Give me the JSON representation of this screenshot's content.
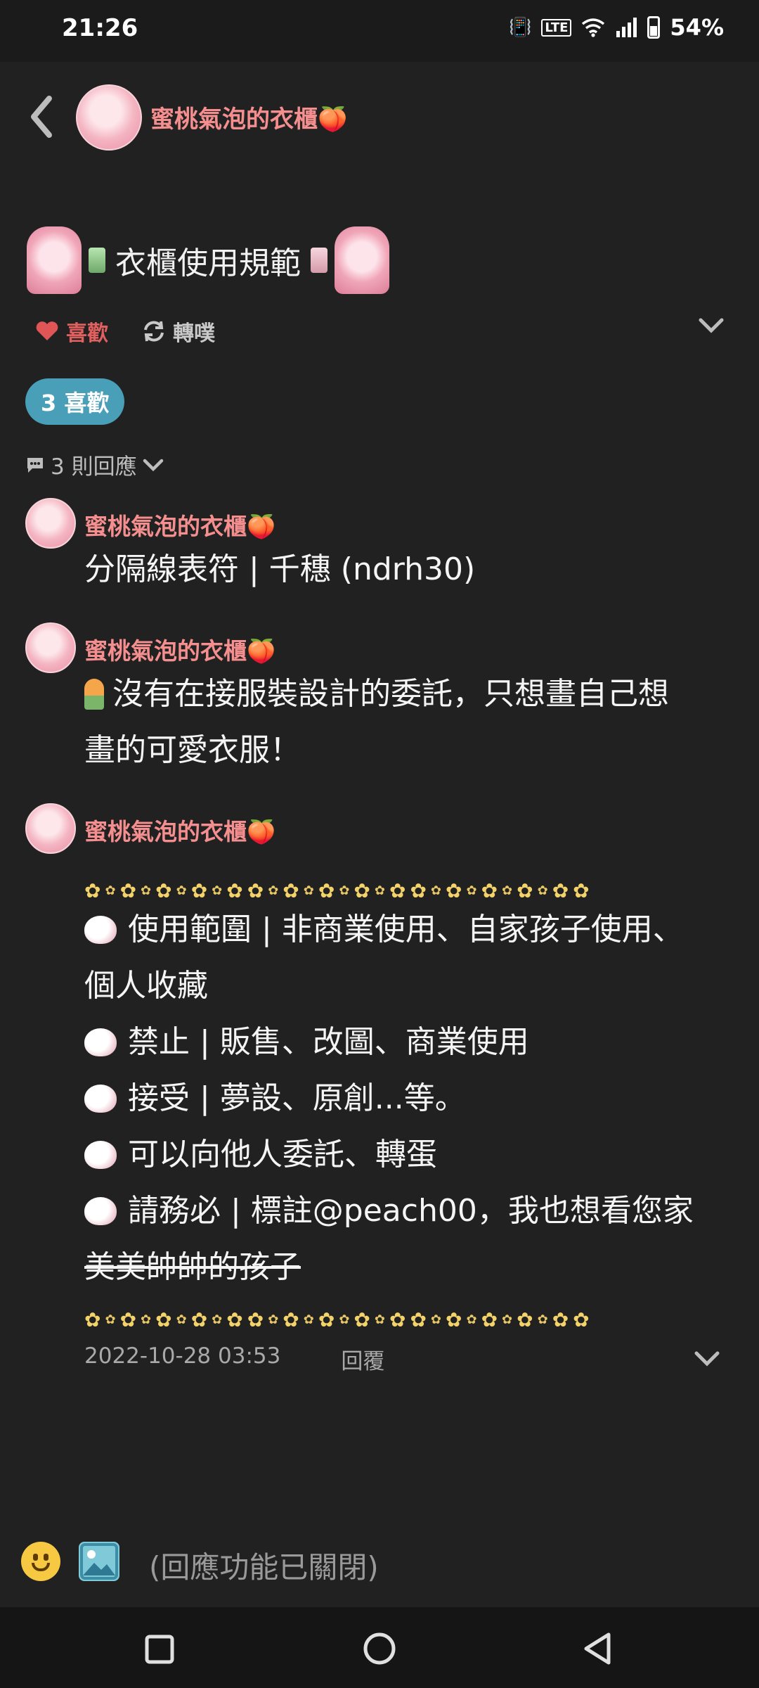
{
  "status_bar": {
    "time": "21:26",
    "network": "LTE",
    "battery": "54%"
  },
  "header": {
    "name": "蜜桃氣泡的衣櫃🍑"
  },
  "post": {
    "title": "衣櫃使用規範",
    "like_label": "喜歡",
    "repost_label": "轉噗",
    "likes_badge": "3 喜歡",
    "replies_toggle": "3 則回應"
  },
  "replies": [
    {
      "author": "蜜桃氣泡的衣櫃🍑",
      "text": "分隔線表符 | 千穗 (ndrh30)"
    },
    {
      "author": "蜜桃氣泡的衣櫃🍑",
      "line1": "沒有在接服裝設計的委託，只想畫自己想",
      "line2": "畫的可愛衣服！"
    },
    {
      "author": "蜜桃氣泡的衣櫃🍑",
      "rules": [
        "使用範圍 | 非商業使用、自家孩子使用、",
        "個人收藏",
        "禁止 | 販售、改圖、商業使用",
        "接受 | 夢設、原創...等。",
        "可以向他人委託、轉蛋",
        "請務必 | 標註@peach00，我也想看您家",
        "美美帥帥的孩子"
      ],
      "timestamp": "2022-10-28 03:53",
      "reply_label": "回覆"
    }
  ],
  "input": {
    "placeholder": "(回應功能已關閉)"
  }
}
